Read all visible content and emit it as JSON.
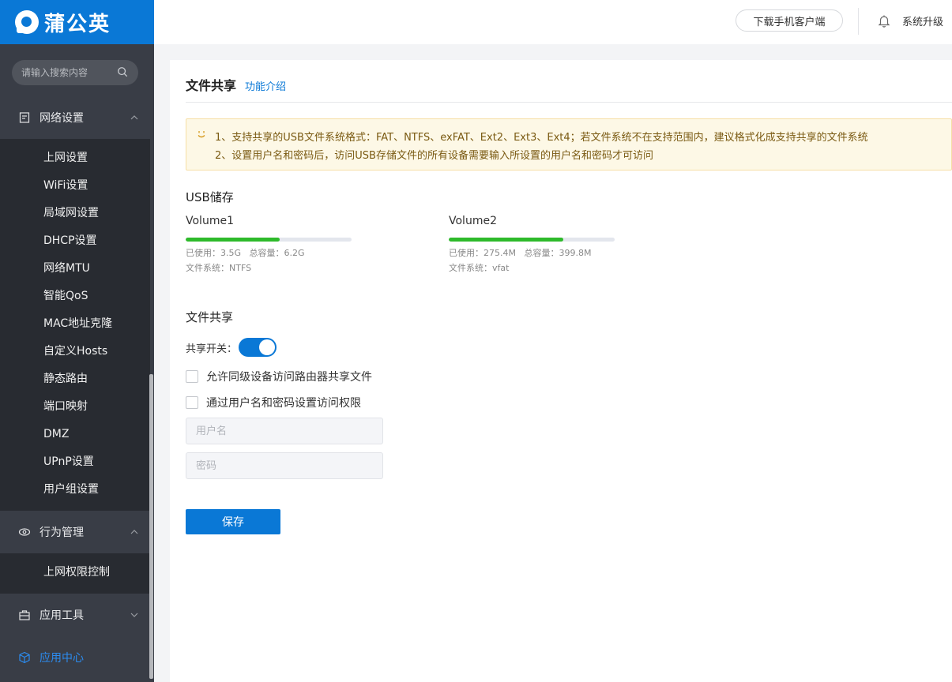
{
  "brand": {
    "name": "蒲公英",
    "color": "#0a78d6"
  },
  "sidebar": {
    "search_placeholder": "请输入搜索内容",
    "groups": [
      {
        "label": "网络设置",
        "icon": "document-icon",
        "expanded": true
      },
      {
        "label": "行为管理",
        "icon": "eye-icon",
        "expanded": true
      },
      {
        "label": "应用工具",
        "icon": "toolbox-icon",
        "expanded": false
      },
      {
        "label": "应用中心",
        "icon": "cube-icon",
        "active": true
      }
    ],
    "network_items": [
      {
        "label": "上网设置"
      },
      {
        "label": "WiFi设置"
      },
      {
        "label": "局域网设置"
      },
      {
        "label": "DHCP设置"
      },
      {
        "label": "网络MTU"
      },
      {
        "label": "智能QoS"
      },
      {
        "label": "MAC地址克隆"
      },
      {
        "label": "自定义Hosts"
      },
      {
        "label": "静态路由"
      },
      {
        "label": "端口映射"
      },
      {
        "label": "DMZ"
      },
      {
        "label": "UPnP设置"
      },
      {
        "label": "用户组设置"
      }
    ],
    "behavior_items": [
      {
        "label": "上网权限控制"
      }
    ]
  },
  "header": {
    "download_label": "下载手机客户端",
    "upgrade_label": "系统升级"
  },
  "page": {
    "title": "文件共享",
    "intro_link": "功能介绍",
    "notice": [
      "1、支持共享的USB文件系统格式：FAT、NTFS、exFAT、Ext2、Ext3、Ext4；若文件系统不在支持范围内，建议格式化成支持共享的文件系统",
      "2、设置用户名和密码后，访问USB存储文件的所有设备需要输入所设置的用户名和密码才可访问"
    ],
    "usb_title": "USB储存",
    "volumes": [
      {
        "name": "Volume1",
        "used_label": "已使用：",
        "used": "3.5G",
        "total_label": "总容量：",
        "total": "6.2G",
        "fs_label": "文件系统：",
        "fs": "NTFS",
        "usage_fraction": 0.565
      },
      {
        "name": "Volume2",
        "used_label": "已使用：",
        "used": "275.4M",
        "total_label": "总容量：",
        "total": "399.8M",
        "fs_label": "文件系统：",
        "fs": "vfat",
        "usage_fraction": 0.689
      }
    ],
    "share_title": "文件共享",
    "switch_label": "共享开关：",
    "switch_on": true,
    "checkbox_same_level": {
      "label": "允许同级设备访问路由器共享文件",
      "checked": false
    },
    "checkbox_auth": {
      "label": "通过用户名和密码设置访问权限",
      "checked": false
    },
    "username": {
      "value": "",
      "placeholder": "用户名"
    },
    "password": {
      "value": "",
      "placeholder": "密码"
    },
    "save_label": "保存"
  }
}
